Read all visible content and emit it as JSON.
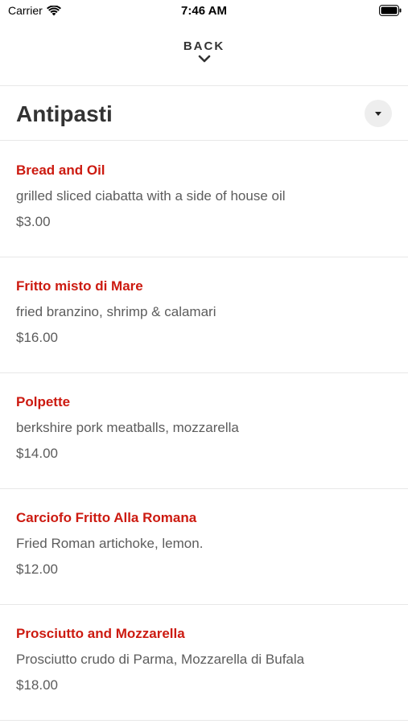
{
  "status_bar": {
    "carrier": "Carrier",
    "time": "7:46 AM"
  },
  "nav": {
    "back_label": "BACK"
  },
  "section": {
    "title": "Antipasti"
  },
  "menu_items": [
    {
      "name": "Bread and Oil",
      "description": "grilled sliced ciabatta with a side of house oil",
      "price": "$3.00"
    },
    {
      "name": "Fritto misto di Mare",
      "description": "fried branzino, shrimp & calamari",
      "price": "$16.00"
    },
    {
      "name": "Polpette",
      "description": "berkshire pork meatballs, mozzarella",
      "price": "$14.00"
    },
    {
      "name": "Carciofo Fritto Alla Romana",
      "description": "Fried Roman artichoke, lemon.",
      "price": "$12.00"
    },
    {
      "name": "Prosciutto and Mozzarella",
      "description": "Prosciutto crudo di Parma, Mozzarella di Bufala",
      "price": "$18.00"
    }
  ],
  "colors": {
    "item_name": "#cc1a10",
    "text_secondary": "#5c5c5c",
    "divider": "#e8e8e8"
  }
}
